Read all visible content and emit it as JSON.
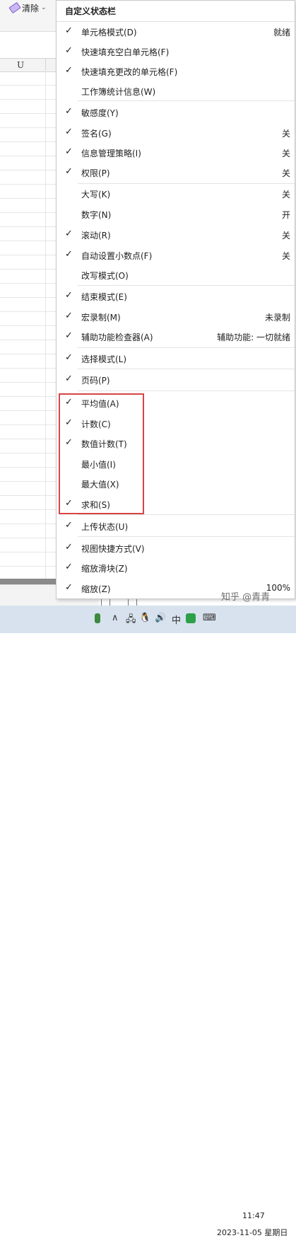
{
  "ribbon": {
    "clear_label": "清除"
  },
  "grid": {
    "column_label": "U"
  },
  "menu": {
    "title": "自定义状态栏",
    "items": [
      {
        "label": "单元格模式(D)",
        "value": "就绪",
        "checked": true
      },
      {
        "label": "快速填充空白单元格(F)",
        "value": "",
        "checked": true
      },
      {
        "label": "快速填充更改的单元格(F)",
        "value": "",
        "checked": true
      },
      {
        "label": "工作簿统计信息(W)",
        "value": "",
        "checked": false
      },
      {
        "label": "敏感度(Y)",
        "value": "",
        "checked": true
      },
      {
        "label": "签名(G)",
        "value": "关",
        "checked": true
      },
      {
        "label": "信息管理策略(I)",
        "value": "关",
        "checked": true
      },
      {
        "label": "权限(P)",
        "value": "关",
        "checked": true
      },
      {
        "label": "大写(K)",
        "value": "关",
        "checked": false
      },
      {
        "label": "数字(N)",
        "value": "开",
        "checked": false
      },
      {
        "label": "滚动(R)",
        "value": "关",
        "checked": true
      },
      {
        "label": "自动设置小数点(F)",
        "value": "关",
        "checked": true
      },
      {
        "label": "改写模式(O)",
        "value": "",
        "checked": false
      },
      {
        "label": "结束模式(E)",
        "value": "",
        "checked": true
      },
      {
        "label": "宏录制(M)",
        "value": "未录制",
        "checked": true
      },
      {
        "label": "辅助功能检查器(A)",
        "value": "辅助功能: 一切就绪",
        "checked": true
      },
      {
        "label": "选择模式(L)",
        "value": "",
        "checked": true
      },
      {
        "label": "页码(P)",
        "value": "",
        "checked": true
      },
      {
        "label": "平均值(A)",
        "value": "",
        "checked": true
      },
      {
        "label": "计数(C)",
        "value": "",
        "checked": true
      },
      {
        "label": "数值计数(T)",
        "value": "",
        "checked": true
      },
      {
        "label": "最小值(I)",
        "value": "",
        "checked": false
      },
      {
        "label": "最大值(X)",
        "value": "",
        "checked": false
      },
      {
        "label": "求和(S)",
        "value": "",
        "checked": true
      },
      {
        "label": "上传状态(U)",
        "value": "",
        "checked": true
      },
      {
        "label": "视图快捷方式(V)",
        "value": "",
        "checked": true
      },
      {
        "label": "缩放滑块(Z)",
        "value": "",
        "checked": true
      },
      {
        "label": "缩放(Z)",
        "value": "100%",
        "checked": true
      }
    ]
  },
  "taskbar": {
    "ime_label": "中",
    "watermark": "知乎 @青青",
    "time": "11:47",
    "date": "2023-11-05 星期日"
  },
  "colors": {
    "highlight": "#d64545",
    "taskbar": "#d7e2ee"
  }
}
